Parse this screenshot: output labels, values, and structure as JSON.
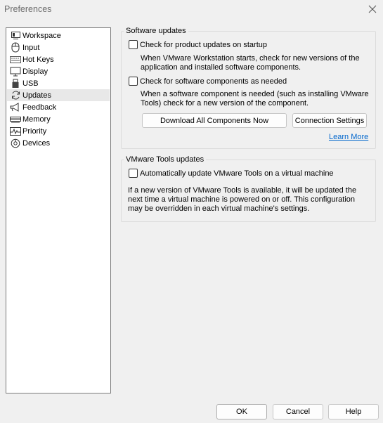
{
  "window": {
    "title": "Preferences"
  },
  "sidebar": {
    "items": [
      {
        "label": "Workspace",
        "icon": "workspace-icon"
      },
      {
        "label": "Input",
        "icon": "mouse-icon"
      },
      {
        "label": "Hot Keys",
        "icon": "keyboard-icon"
      },
      {
        "label": "Display",
        "icon": "monitor-icon"
      },
      {
        "label": "USB",
        "icon": "usb-icon"
      },
      {
        "label": "Updates",
        "icon": "refresh-icon",
        "selected": true
      },
      {
        "label": "Feedback",
        "icon": "megaphone-icon"
      },
      {
        "label": "Memory",
        "icon": "memory-chip-icon"
      },
      {
        "label": "Priority",
        "icon": "activity-graph-icon"
      },
      {
        "label": "Devices",
        "icon": "devices-icon"
      }
    ]
  },
  "software_updates": {
    "title": "Software updates",
    "check_product": {
      "label": "Check for product updates on startup",
      "checked": false
    },
    "product_desc_1": "When VMware Workstation starts, check for new versions of the",
    "product_desc_2": "application and installed software components.",
    "check_components": {
      "label": "Check for software components as needed",
      "checked": false
    },
    "components_desc_1": "When a software component is needed (such as installing VMware",
    "components_desc_2": "Tools) check for a new version of the component.",
    "download_button": "Download All Components Now",
    "connection_button": "Connection Settings",
    "learn_more": "Learn More"
  },
  "tools_updates": {
    "title": "VMware Tools updates",
    "auto_update": {
      "label": "Automatically update VMware Tools on a virtual machine",
      "checked": false
    },
    "desc_1": "If a new version of VMware Tools is available, it will be updated the",
    "desc_2": "next time a virtual machine is powered on or off. This configuration",
    "desc_3": "may be overridden in each virtual machine's settings."
  },
  "footer": {
    "ok": "OK",
    "cancel": "Cancel",
    "help": "Help"
  }
}
